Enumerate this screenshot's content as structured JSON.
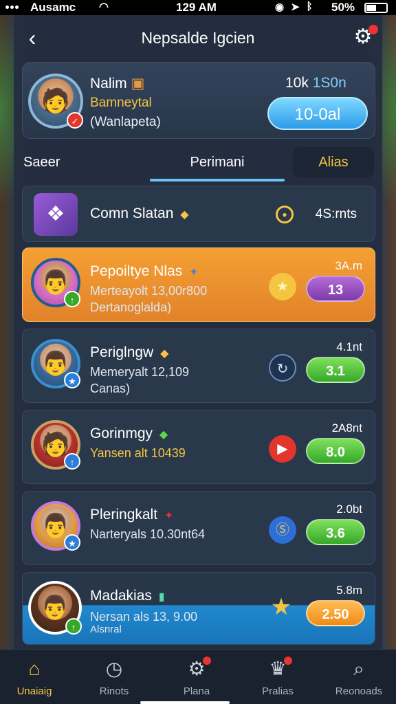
{
  "status_bar": {
    "carrier": "Ausamc",
    "time": "129 AM",
    "battery": "50%"
  },
  "header": {
    "title": "Nepsalde Igcien"
  },
  "profile": {
    "name": "Nalim",
    "subtitle": "Bamneytal",
    "meta": "(Wanlapeta)",
    "stat_prefix": "10k",
    "stat_value": "1S0n",
    "button_label": "10-0al"
  },
  "tabs": [
    {
      "label": "Saeer"
    },
    {
      "label": "Perimani"
    },
    {
      "label": "Alias"
    }
  ],
  "rows": [
    {
      "name": "Comn Slatan",
      "line1": "",
      "line2": "",
      "right_label": "",
      "value": "4S:rnts"
    },
    {
      "name": "Pepoiltye Nlas",
      "line1": "Merteayolt 13,00r800",
      "line2": "Dertanoglalda)",
      "right_label": "3A.m",
      "value": "13"
    },
    {
      "name": "Periglngw",
      "line1": "Memeryalt 12,109",
      "line2": "Canas)",
      "right_label": "4.1nt",
      "value": "3.1"
    },
    {
      "name": "Gorinmgy",
      "line1": "Yansen alt 10439",
      "line2": "",
      "right_label": "2A8nt",
      "value": "8.0"
    },
    {
      "name": "Pleringkalt",
      "line1": "Narteryals 10.30nt64",
      "line2": "",
      "right_label": "2.0bt",
      "value": "3.6"
    },
    {
      "name": "Madakias",
      "line1": "Nersan als 13, 9.00",
      "line2": "Alsnral",
      "right_label": "5.8m",
      "value": "2.50"
    }
  ],
  "bottom_nav": [
    {
      "label": "Unaiaig",
      "icon": "home-icon"
    },
    {
      "label": "Rinots",
      "icon": "clock-icon"
    },
    {
      "label": "Plana",
      "icon": "gear-icon"
    },
    {
      "label": "Pralias",
      "icon": "trophy-icon"
    },
    {
      "label": "Reonoads",
      "icon": "search-icon"
    }
  ]
}
